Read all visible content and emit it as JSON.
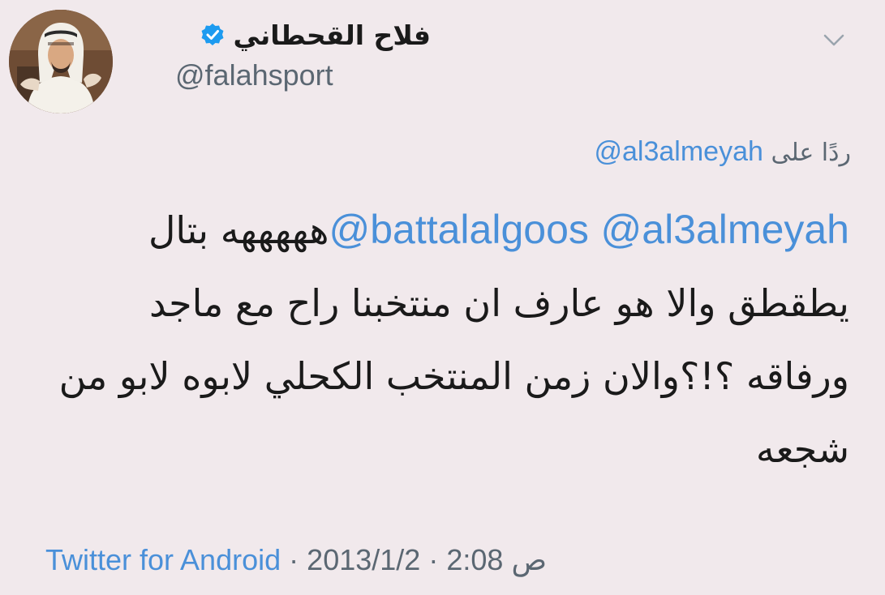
{
  "author": {
    "display_name": "فلاح القحطاني",
    "handle": "@falahsport",
    "verified": true
  },
  "reply_context": {
    "prefix": "ردًا على",
    "mention": "@al3almeyah"
  },
  "tweet": {
    "mention_1": "@al3almeyah",
    "mention_2": "@battalalgoos",
    "line_1_text": "هههههه بتال",
    "line_2_text": "يطقطق والا هو عارف ان منتخبنا راح مع ماجد",
    "line_3_text": "ورفاقه ؟!؟والان زمن المنتخب الكحلي لابوه لابو من",
    "line_4_text": "شجعه"
  },
  "meta": {
    "source": "Twitter for Android",
    "separator": "·",
    "date": "2013/1/2",
    "time": "2:08",
    "period": "ص"
  },
  "colors": {
    "background": "#f1e9ec",
    "link": "#4a90d9",
    "secondary_text": "#5b6772",
    "verified_badge": "#1d9bf0"
  },
  "icons": {
    "verified": "verified-badge-icon",
    "menu": "chevron-down-icon"
  }
}
